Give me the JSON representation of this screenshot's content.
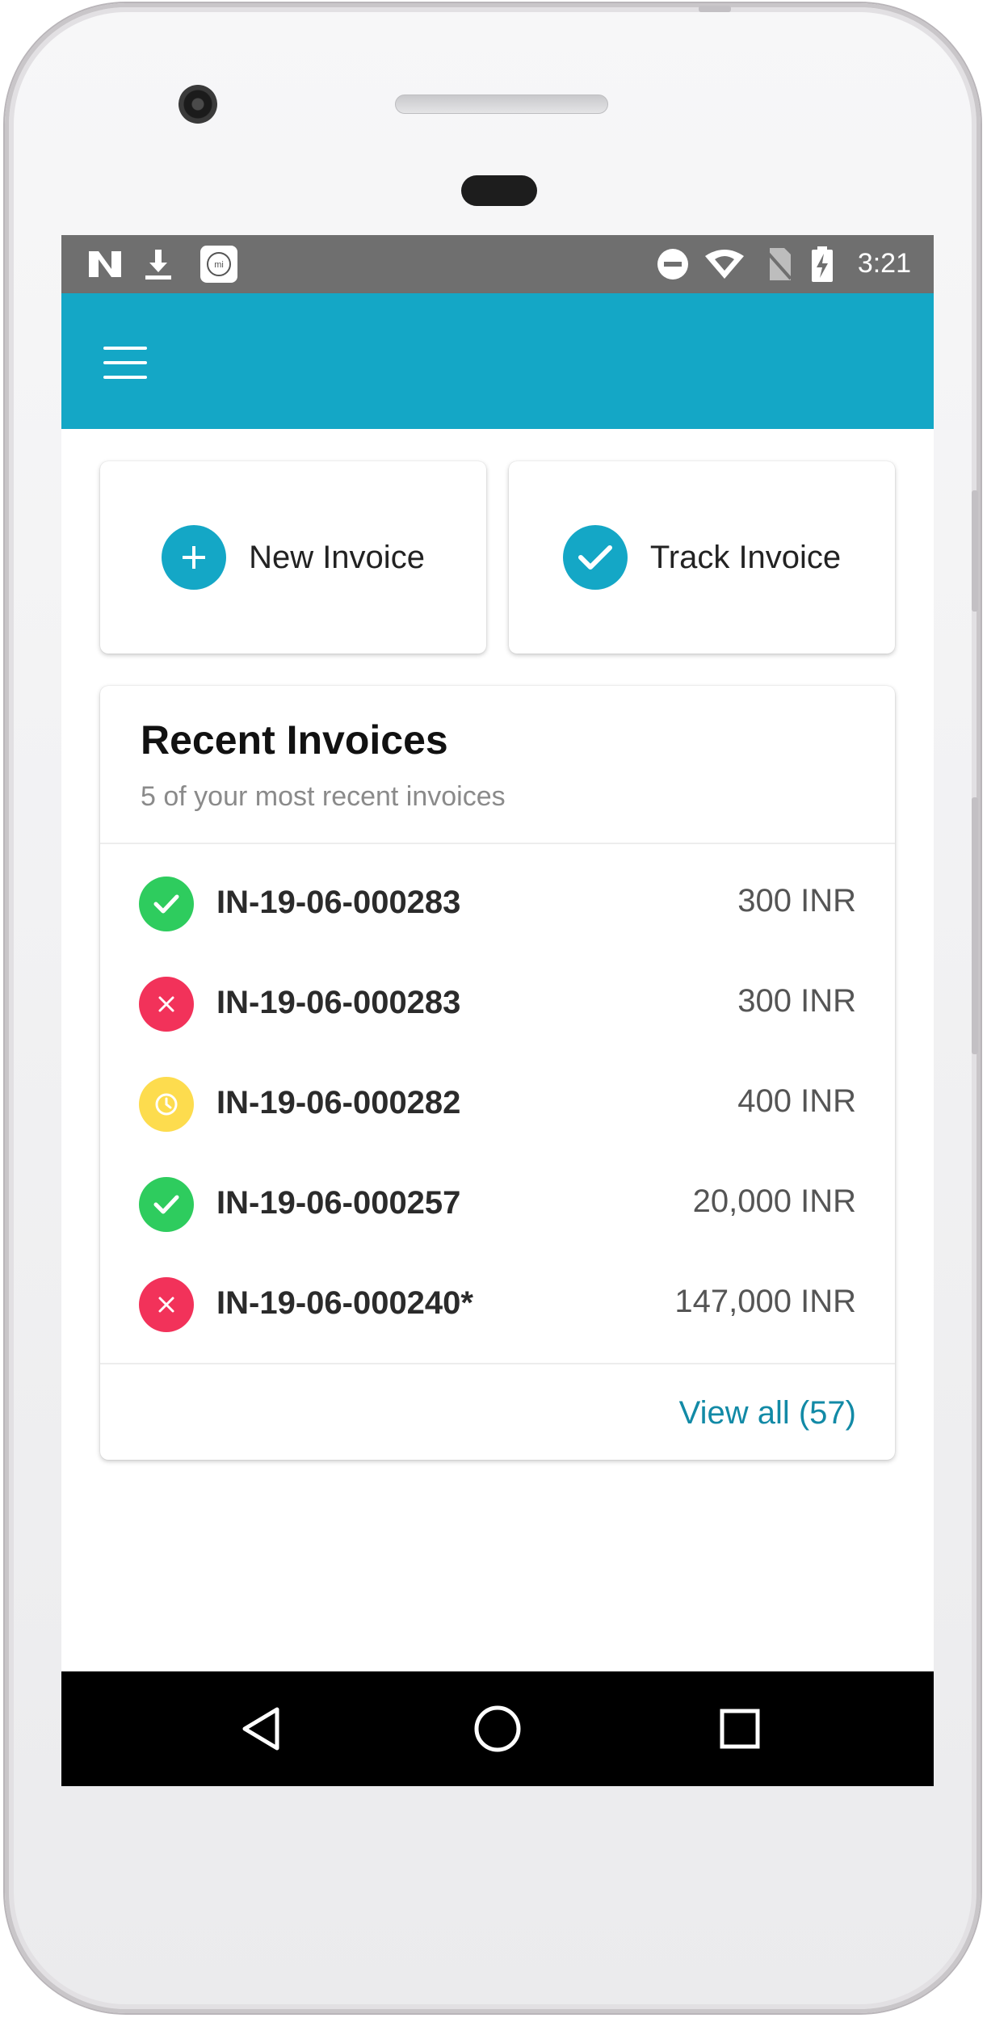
{
  "status_bar": {
    "time": "3:21",
    "left_icons": [
      "n-logo-icon",
      "download-icon",
      "mi-app-icon"
    ],
    "right_icons": [
      "do-not-disturb-icon",
      "wifi-icon",
      "no-sim-icon",
      "battery-charging-icon"
    ]
  },
  "app_bar": {
    "menu_icon": "hamburger-menu-icon",
    "color": "#14a7c6"
  },
  "actions": [
    {
      "label": "New Invoice",
      "icon": "plus-icon"
    },
    {
      "label": "Track Invoice",
      "icon": "check-icon"
    }
  ],
  "recent": {
    "title": "Recent Invoices",
    "subtitle": "5 of your most recent invoices",
    "items": [
      {
        "id": "IN-19-06-000283",
        "amount": "300 INR",
        "status": "approved",
        "icon": "check-icon",
        "color": "#2ecc5e"
      },
      {
        "id": "IN-19-06-000283",
        "amount": "300 INR",
        "status": "rejected",
        "icon": "close-icon",
        "color": "#f2325a"
      },
      {
        "id": "IN-19-06-000282",
        "amount": "400 INR",
        "status": "pending",
        "icon": "clock-icon",
        "color": "#fddc4e"
      },
      {
        "id": "IN-19-06-000257",
        "amount": "20,000 INR",
        "status": "approved",
        "icon": "check-icon",
        "color": "#2ecc5e"
      },
      {
        "id": "IN-19-06-000240*",
        "amount": "147,000 INR",
        "status": "rejected",
        "icon": "close-icon",
        "color": "#f2325a"
      }
    ],
    "view_all": "View all (57)"
  },
  "nav_bar": {
    "buttons": [
      "back-icon",
      "home-icon",
      "recents-icon"
    ]
  }
}
